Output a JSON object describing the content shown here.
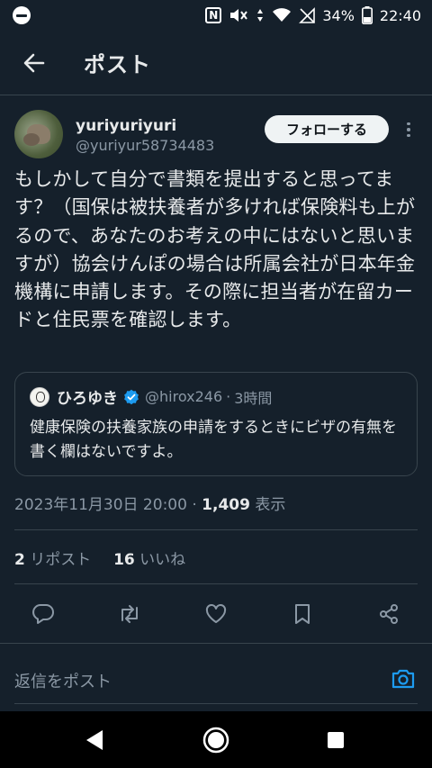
{
  "status_bar": {
    "battery_percent": "34%",
    "time": "22:40",
    "nfc_label": "N"
  },
  "header": {
    "title": "ポスト"
  },
  "tweet": {
    "display_name": "yuriyuriyuri",
    "handle": "@yuriyur58734483",
    "follow_label": "フォローする",
    "text": "もしかして自分で書類を提出すると思ってます？（国保は被扶養者が多ければ保険料も上がるので、あなたのお考えの中にはないと思いますが）協会けんぽの場合は所属会社が日本年金機構に申請します。その際に担当者が在留カードと住民票を確認します。",
    "quote": {
      "display_name": "ひろゆき",
      "handle": "@hirox246",
      "separator": "·",
      "time": "3時間",
      "text": "健康保険の扶養家族の申請をするときにビザの有無を書く欄はないですよ。"
    },
    "timestamp": "2023年11月30日 20:00",
    "meta_separator": "·",
    "views_count": "1,409",
    "views_label": "表示",
    "reposts_count": "2",
    "reposts_label": "リポスト",
    "likes_count": "16",
    "likes_label": "いいね"
  },
  "reply_bar": {
    "placeholder": "返信をポスト"
  },
  "colors": {
    "background": "#15202b",
    "accent": "#1d9bf0",
    "text_primary": "#e7e9ea",
    "text_secondary": "#8b98a5",
    "divider": "#38444d"
  },
  "icons": {
    "back": "arrow-left-icon",
    "more": "more-vertical-icon",
    "verified": "verified-badge-icon",
    "reply": "reply-icon",
    "repost": "repost-icon",
    "like": "heart-icon",
    "bookmark": "bookmark-icon",
    "share": "share-icon",
    "camera": "camera-icon"
  }
}
